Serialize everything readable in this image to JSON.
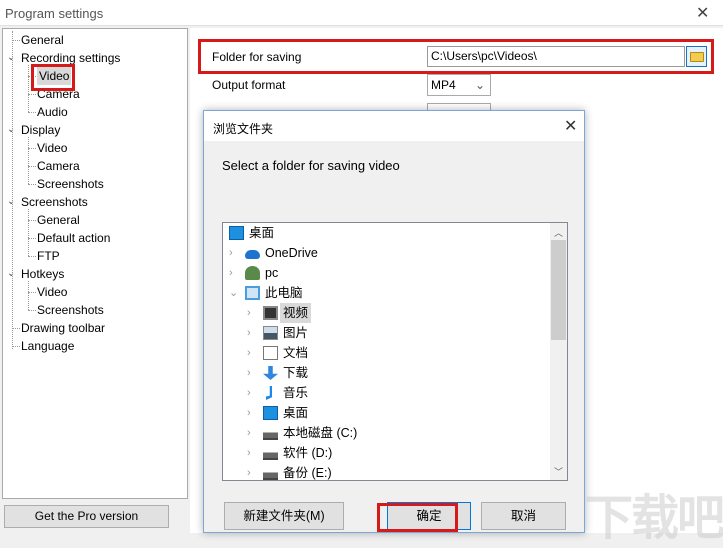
{
  "window": {
    "title": "Program settings"
  },
  "tree": [
    {
      "label": "General",
      "level": 0
    },
    {
      "label": "Recording settings",
      "level": 0,
      "expanded": true
    },
    {
      "label": "Video",
      "level": 1,
      "selected": true
    },
    {
      "label": "Camera",
      "level": 1
    },
    {
      "label": "Audio",
      "level": 1
    },
    {
      "label": "Display",
      "level": 0,
      "expanded": true
    },
    {
      "label": "Video",
      "level": 1
    },
    {
      "label": "Camera",
      "level": 1
    },
    {
      "label": "Screenshots",
      "level": 1
    },
    {
      "label": "Screenshots",
      "level": 0,
      "expanded": true
    },
    {
      "label": "General",
      "level": 1
    },
    {
      "label": "Default action",
      "level": 1
    },
    {
      "label": "FTP",
      "level": 1
    },
    {
      "label": "Hotkeys",
      "level": 0,
      "expanded": true
    },
    {
      "label": "Video",
      "level": 1
    },
    {
      "label": "Screenshots",
      "level": 1
    },
    {
      "label": "Drawing toolbar",
      "level": 0
    },
    {
      "label": "Language",
      "level": 0
    }
  ],
  "pro_button": "Get the Pro version",
  "settings": {
    "folder_label": "Folder for saving",
    "folder_value": "C:\\Users\\pc\\Videos\\",
    "format_label": "Output format",
    "format_value": "MP4"
  },
  "dialog": {
    "title": "浏览文件夹",
    "prompt": "Select a folder for saving video",
    "items": [
      {
        "label": "桌面",
        "icon": "desktop-icon",
        "depth": 0,
        "arrow": ""
      },
      {
        "label": "OneDrive",
        "icon": "cloud-icon",
        "depth": 0,
        "arrow": ">"
      },
      {
        "label": "pc",
        "icon": "user-icon",
        "depth": 0,
        "arrow": ">"
      },
      {
        "label": "此电脑",
        "icon": "computer-icon",
        "depth": 0,
        "arrow": "v"
      },
      {
        "label": "视频",
        "icon": "video-folder-icon",
        "depth": 1,
        "arrow": ">",
        "selected": true
      },
      {
        "label": "图片",
        "icon": "pictures-icon",
        "depth": 1,
        "arrow": ">"
      },
      {
        "label": "文档",
        "icon": "documents-icon",
        "depth": 1,
        "arrow": ">"
      },
      {
        "label": "下载",
        "icon": "download-icon",
        "depth": 1,
        "arrow": ">"
      },
      {
        "label": "音乐",
        "icon": "music-icon",
        "depth": 1,
        "arrow": ">"
      },
      {
        "label": "桌面",
        "icon": "desktop-icon",
        "depth": 1,
        "arrow": ">"
      },
      {
        "label": "本地磁盘 (C:)",
        "icon": "system-drive-icon",
        "depth": 1,
        "arrow": ">"
      },
      {
        "label": "软件 (D:)",
        "icon": "drive-icon",
        "depth": 1,
        "arrow": ">"
      },
      {
        "label": "备份 (E:)",
        "icon": "drive-icon",
        "depth": 1,
        "arrow": ">"
      }
    ],
    "new_folder": "新建文件夹(M)",
    "ok": "确定",
    "cancel": "取消"
  },
  "colors": {
    "highlight": "#d61a1a",
    "accent": "#0078d7"
  }
}
